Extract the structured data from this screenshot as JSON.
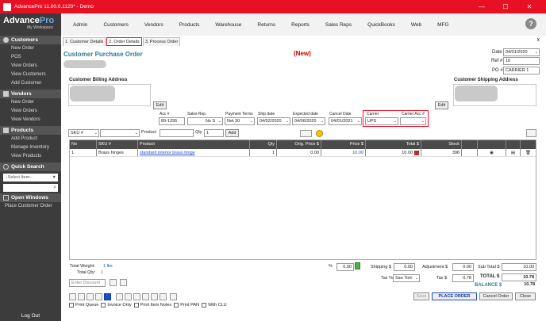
{
  "window": {
    "title": "AdvancePro 11.00.0.1120* - Demo",
    "min": "—",
    "max": "☐",
    "close": "✕"
  },
  "sidebar": {
    "brand": "AdvancePro",
    "brand_a": "Advance",
    "brand_b": "Pro",
    "subtitle": "My Workspace",
    "customers": {
      "title": "Customers",
      "items": [
        "New Order",
        "POS",
        "View Orders",
        "View Customers",
        "Add Customer"
      ]
    },
    "vendors": {
      "title": "Vendors",
      "items": [
        "New Order",
        "View Orders",
        "View Vendors"
      ]
    },
    "products": {
      "title": "Products",
      "items": [
        "Add Product",
        "Manage Inventory",
        "View Products"
      ]
    },
    "quick_search": {
      "title": "Quick Search",
      "select": "--Select Item--"
    },
    "open_windows": {
      "title": "Open Windows",
      "items": [
        "Place Customer Order"
      ]
    },
    "logout": "Log Out"
  },
  "menu": [
    "Admin",
    "Customers",
    "Vendors",
    "Products",
    "Warehouse",
    "Returns",
    "Reports",
    "Sales Reps",
    "QuickBooks",
    "Web",
    "MFG"
  ],
  "help": "?",
  "tabs": [
    "1. Customer Details",
    "2. Order Details",
    "3. Process Order"
  ],
  "tab_close": "x",
  "form": {
    "title": "Customer Purchase Order",
    "status": "(New)",
    "date_label": "Date",
    "date": "04/01/2020",
    "ref_label": "Ref #",
    "ref": "16",
    "po_label": "PO #",
    "po": "CARRIER 1",
    "billing_label": "Customer Billing Address",
    "shipping_label": "Customer Shipping Address",
    "edit": "Edit",
    "acc_label": "Acc #",
    "acc": "89-1295",
    "rep_label": "Sales Rep",
    "rep": "No S",
    "terms_label": "Payment Terms",
    "terms": "Net 30",
    "ship_label": "Ship date",
    "ship": "04/02/2020",
    "expected_label": "Expected date",
    "expected": "04/06/2020",
    "cancel_label": "Cancel Date",
    "cancel": "04/01/2021",
    "carrier_label": "Carrier",
    "carrier": "UPS",
    "carrier_acc_label": "Carrier Acc #",
    "carrier_acc": ""
  },
  "itembar": {
    "sku_label": "SKU #",
    "product_label": "Product",
    "qty_label": "Qty",
    "qty": "1",
    "add": "Add"
  },
  "grid": {
    "headers": [
      "No",
      "SKU #",
      "Product",
      "Qty",
      "Orig. Price $",
      "Price $",
      "Total $",
      "Stock"
    ],
    "row": {
      "no": "1",
      "sku": "Brass hinges",
      "product": "standard interior brass hinge",
      "qty": "1",
      "orig": "0.00",
      "price": "10.00",
      "total": "10.00",
      "stock": "398"
    }
  },
  "totals": {
    "weight_label": "Total Weight:",
    "weight": "1 lbs",
    "qty_label": "Total Qty:",
    "qty": "1",
    "discount_placeholder": "Enter Discount",
    "pct_label": "%",
    "pct": "0.00",
    "shipping_label": "Shipping $",
    "shipping": "0.00",
    "adjust_label": "Adjustment $",
    "adjust": "0.00",
    "subtotal_label": "Sub Total $",
    "subtotal": "10.00",
    "taxpct_label": "Tax %",
    "taxpct": "San Tom",
    "tax_label": "Tax $",
    "tax": "0.78",
    "total_label": "TOTAL $",
    "total": "10.78",
    "balance_label": "BALANCE $",
    "balance": "10.78"
  },
  "buttons": {
    "save": "Save",
    "place": "PLACE ORDER",
    "cancel": "Cancel Order",
    "close": "Close"
  },
  "checks": [
    "Print Queue",
    "Invoice Only",
    "Print Item Notes",
    "Print PAN",
    "With CLU"
  ]
}
